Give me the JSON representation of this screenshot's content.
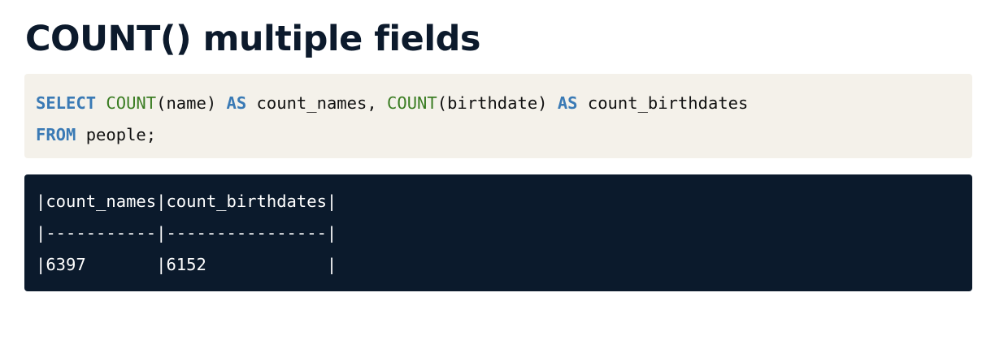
{
  "title": "COUNT() multiple fields",
  "query": {
    "line1": {
      "select_kw": "SELECT",
      "fn1": "COUNT",
      "arg1": "(name) ",
      "as_kw1": "AS",
      "alias1": " count_names, ",
      "fn2": "COUNT",
      "arg2": "(birthdate) ",
      "as_kw2": "AS",
      "alias2": " count_birthdates"
    },
    "line2": {
      "from_kw": "FROM",
      "table": " people;"
    }
  },
  "result": {
    "header": "|count_names|count_birthdates|",
    "separator": "|-----------|----------------|",
    "rows": [
      "|6397       |6152            |"
    ]
  },
  "colors": {
    "title": "#0c1a2c",
    "code_background": "#f4f1ea",
    "keyword": "#3a7ab5",
    "function": "#3b7d23",
    "result_background": "#0b1a2c",
    "result_text": "#ffffff"
  }
}
